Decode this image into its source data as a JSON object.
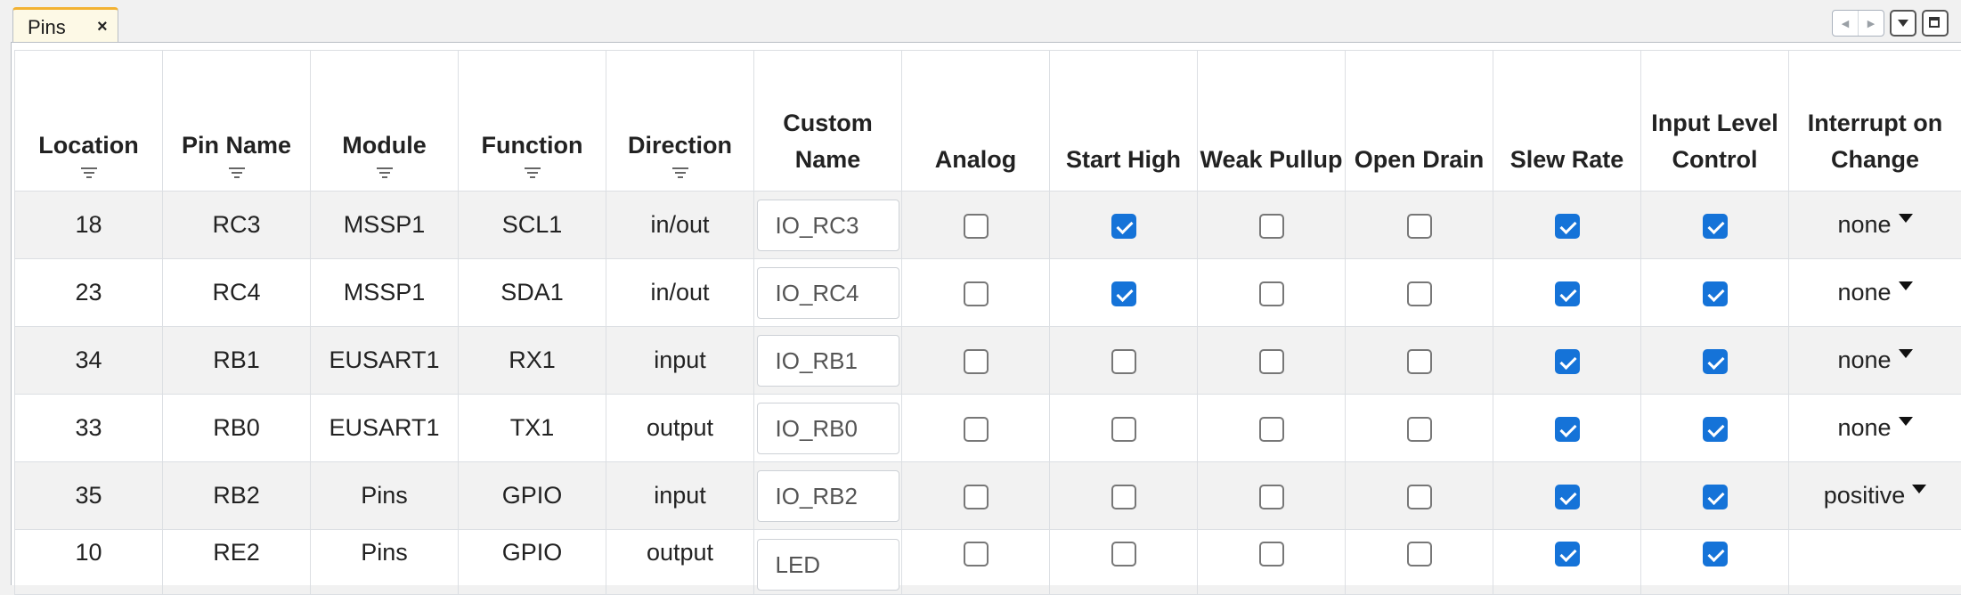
{
  "tab": {
    "label": "Pins",
    "close": "×"
  },
  "controls": {
    "prev": "◀",
    "next": "▶"
  },
  "columns": {
    "location": "Location",
    "pin_name": "Pin Name",
    "module": "Module",
    "function": "Function",
    "direction": "Direction",
    "custom_name": "Custom Name",
    "analog": "Analog",
    "start_high": "Start High",
    "weak_pullup": "Weak Pullup",
    "open_drain": "Open Drain",
    "slew_rate": "Slew Rate",
    "input_level_control": "Input Level Control",
    "interrupt_on_change": "Interrupt on Change"
  },
  "rows": [
    {
      "location": "18",
      "pin_name": "RC3",
      "module": "MSSP1",
      "function": "SCL1",
      "direction": "in/out",
      "custom_name": "IO_RC3",
      "analog": false,
      "start_high": true,
      "weak_pullup": false,
      "open_drain": false,
      "slew_rate": true,
      "input_level_control": true,
      "interrupt_on_change": "none"
    },
    {
      "location": "23",
      "pin_name": "RC4",
      "module": "MSSP1",
      "function": "SDA1",
      "direction": "in/out",
      "custom_name": "IO_RC4",
      "analog": false,
      "start_high": true,
      "weak_pullup": false,
      "open_drain": false,
      "slew_rate": true,
      "input_level_control": true,
      "interrupt_on_change": "none"
    },
    {
      "location": "34",
      "pin_name": "RB1",
      "module": "EUSART1",
      "function": "RX1",
      "direction": "input",
      "custom_name": "IO_RB1",
      "analog": false,
      "start_high": false,
      "weak_pullup": false,
      "open_drain": false,
      "slew_rate": true,
      "input_level_control": true,
      "interrupt_on_change": "none"
    },
    {
      "location": "33",
      "pin_name": "RB0",
      "module": "EUSART1",
      "function": "TX1",
      "direction": "output",
      "custom_name": "IO_RB0",
      "analog": false,
      "start_high": false,
      "weak_pullup": false,
      "open_drain": false,
      "slew_rate": true,
      "input_level_control": true,
      "interrupt_on_change": "none"
    },
    {
      "location": "35",
      "pin_name": "RB2",
      "module": "Pins",
      "function": "GPIO",
      "direction": "input",
      "custom_name": "IO_RB2",
      "analog": false,
      "start_high": false,
      "weak_pullup": false,
      "open_drain": false,
      "slew_rate": true,
      "input_level_control": true,
      "interrupt_on_change": "positive"
    },
    {
      "location": "10",
      "pin_name": "RE2",
      "module": "Pins",
      "function": "GPIO",
      "direction": "output",
      "custom_name": "LED",
      "analog": false,
      "start_high": false,
      "weak_pullup": false,
      "open_drain": false,
      "slew_rate": true,
      "input_level_control": true,
      "interrupt_on_change": ""
    }
  ],
  "colors": {
    "tab_accent": "#f2b233",
    "checkbox_on": "#1573d8",
    "row_alt": "#f2f2f2"
  }
}
